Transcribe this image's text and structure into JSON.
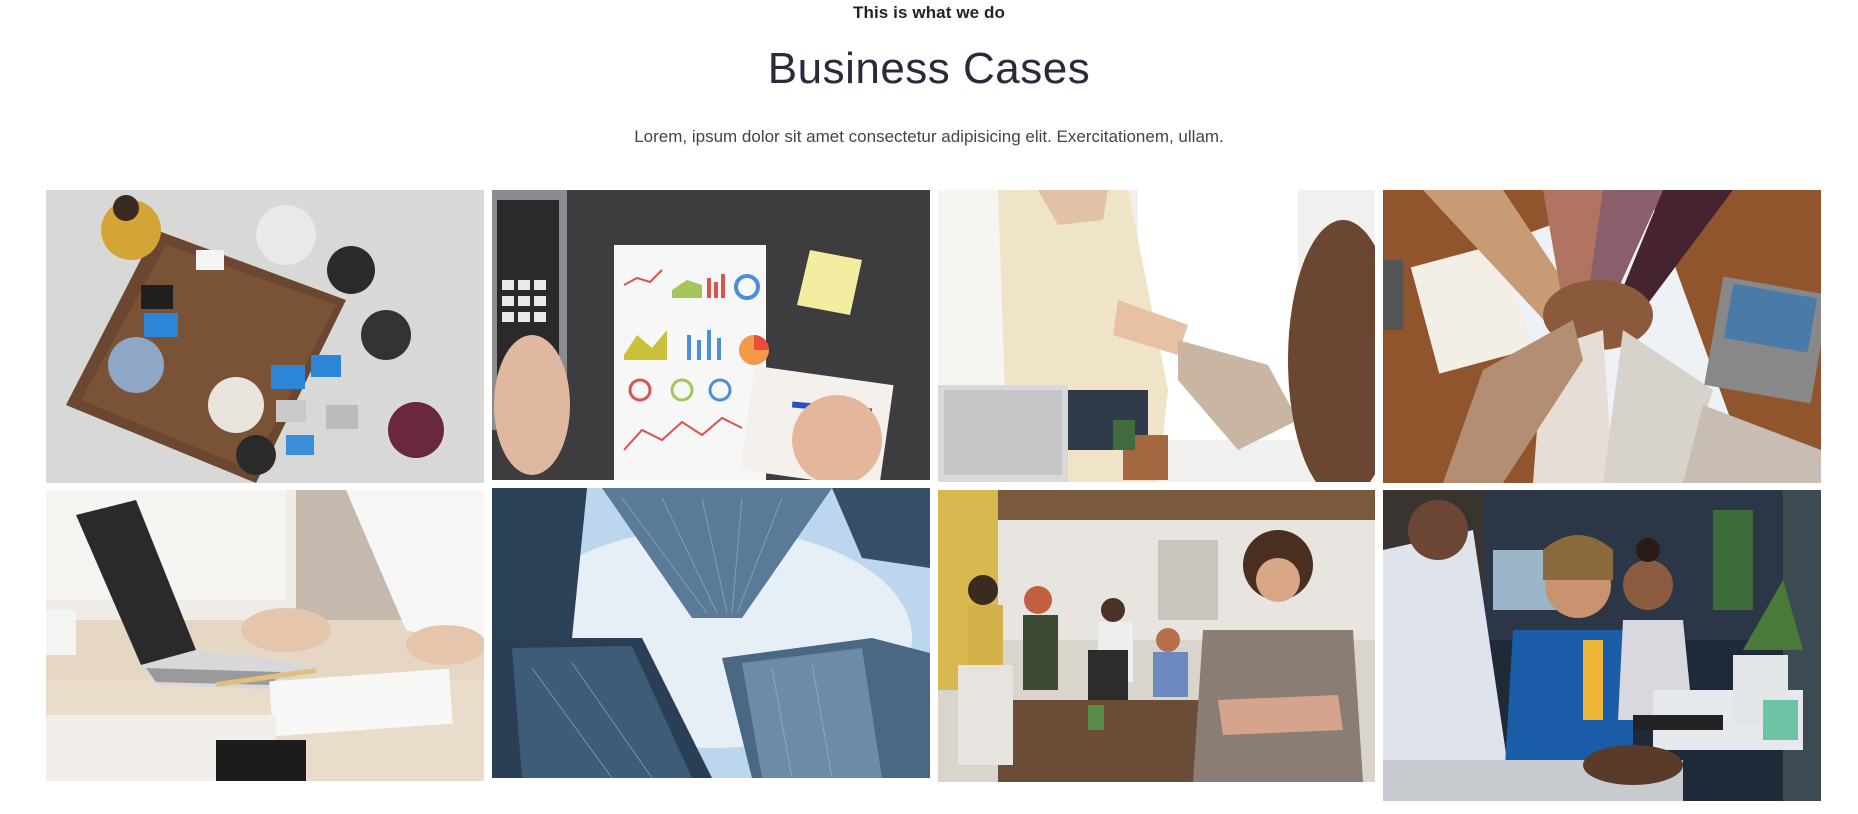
{
  "section": {
    "eyebrow": "This is what we do",
    "title": "Business Cases",
    "subtitle": "Lorem, ipsum dolor sit amet consectetur adipisicing elit. Exercitationem, ullam."
  },
  "gallery": {
    "items": [
      {
        "name": "team-meeting-overhead-photo"
      },
      {
        "name": "charts-report-desk-photo"
      },
      {
        "name": "handshake-photo"
      },
      {
        "name": "team-hands-stack-photo"
      },
      {
        "name": "laptop-typing-photo"
      },
      {
        "name": "skyscrapers-upward-photo"
      },
      {
        "name": "smiling-woman-office-photo"
      },
      {
        "name": "smiling-colleagues-desk-photo"
      }
    ]
  },
  "colors": {
    "background": "#ffffff",
    "heading": "#2a2a3a",
    "text": "#444444"
  }
}
